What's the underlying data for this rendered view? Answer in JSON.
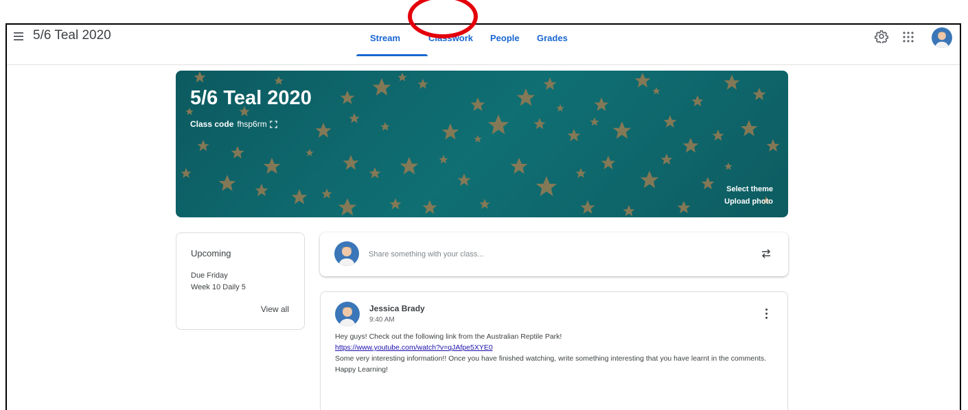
{
  "header": {
    "class_name": "5/6 Teal 2020",
    "tabs": [
      "Stream",
      "Classwork",
      "People",
      "Grades"
    ],
    "active_tab": "Stream",
    "highlighted_tab": "Classwork"
  },
  "banner": {
    "title": "5/6 Teal 2020",
    "class_code_label": "Class code",
    "class_code": "fhsp6rm",
    "select_theme": "Select theme",
    "upload_photo": "Upload photo"
  },
  "upcoming": {
    "title": "Upcoming",
    "due": "Due Friday",
    "item": "Week 10 Daily 5",
    "view_all": "View all"
  },
  "share": {
    "placeholder": "Share something with your class..."
  },
  "post": {
    "author": "Jessica Brady",
    "time": "9:40 AM",
    "line1": "Hey guys! Check out the following link from the Australian Reptile Park!",
    "link": "https://www.youtube.com/watch?v=qJAfpe5XYE0",
    "line2": "Some very interesting information!! Once you have finished watching, write something interesting that you have learnt in the comments.",
    "line3": "Happy Learning!"
  },
  "colors": {
    "accent": "#1967d2",
    "banner": "#0f6f73",
    "star": "#8a7a55",
    "highlight": "#e3000b"
  },
  "icons": [
    "menu-icon",
    "gear-icon",
    "apps-icon",
    "avatar",
    "expand-icon",
    "repost-icon",
    "more-vert-icon"
  ]
}
